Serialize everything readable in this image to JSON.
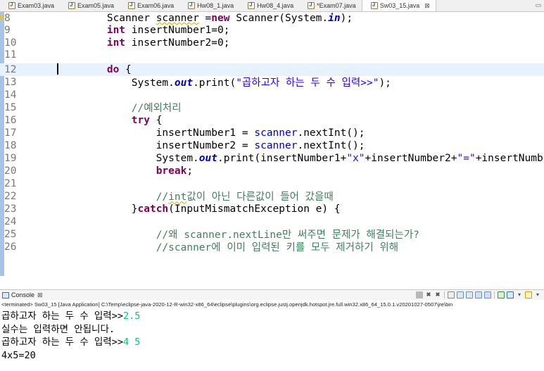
{
  "tabs": [
    {
      "label": "Exam03.java",
      "active": false
    },
    {
      "label": "Exam05.java",
      "active": false
    },
    {
      "label": "Exam06.java",
      "active": false
    },
    {
      "label": "Hw08_1.java",
      "active": false
    },
    {
      "label": "Hw08_4.java",
      "active": false
    },
    {
      "label": "*Exam07.java",
      "active": false
    },
    {
      "label": "Sw03_15.java",
      "active": true
    }
  ],
  "tab_close_glyph": "⊠",
  "editor": {
    "line_numbers": [
      "8",
      "9",
      "10",
      "11",
      "12",
      "13",
      "14",
      "15",
      "16",
      "17",
      "18",
      "19",
      "20",
      "21",
      "22",
      "23",
      "24",
      "25",
      "26"
    ],
    "current_line": "12"
  },
  "console": {
    "title": "Console",
    "close_glyph": "⊠",
    "terminated": "<terminated> Sw03_15 [Java Application] C:\\Temp\\eclipse-java-2020-12-R-win32-x86_64\\eclipse\\plugins\\org.eclipse.justj.openjdk.hotspot.jre.full.win32.x86_64_15.0.1.v20201027-0507\\jre\\bin",
    "output": [
      {
        "text": "곱하고자 하는 두 수 입력>>",
        "input": "2.5"
      },
      {
        "text": "실수는 입력하면 안됩니다.",
        "input": ""
      },
      {
        "text": "곱하고자 하는 두 수 입력>>",
        "input": "4 5"
      },
      {
        "text": "4x5=20",
        "input": ""
      }
    ]
  },
  "colors": {
    "keyword": "#7f0055",
    "string": "#2a00ff",
    "comment": "#3f7f5f",
    "field": "#0000c0",
    "input_echo": "#00c87d",
    "current_line": "#e8f2fe"
  }
}
